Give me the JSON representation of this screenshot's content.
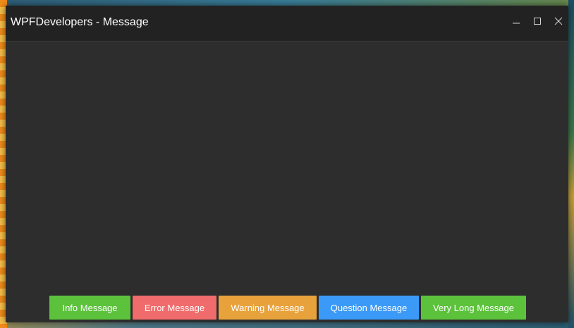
{
  "window": {
    "title": "WPFDevelopers - Message"
  },
  "caption": {
    "minimize_icon": "minimize-icon",
    "maximize_icon": "maximize-icon",
    "close_icon": "close-icon"
  },
  "buttons": [
    {
      "label": "Info Message",
      "color": "#5cc23c"
    },
    {
      "label": "Error Message",
      "color": "#f06b6b"
    },
    {
      "label": "Warning Message",
      "color": "#e8a23c"
    },
    {
      "label": "Question Message",
      "color": "#3b9af7"
    },
    {
      "label": "Very Long Message",
      "color": "#5cc23c"
    }
  ]
}
